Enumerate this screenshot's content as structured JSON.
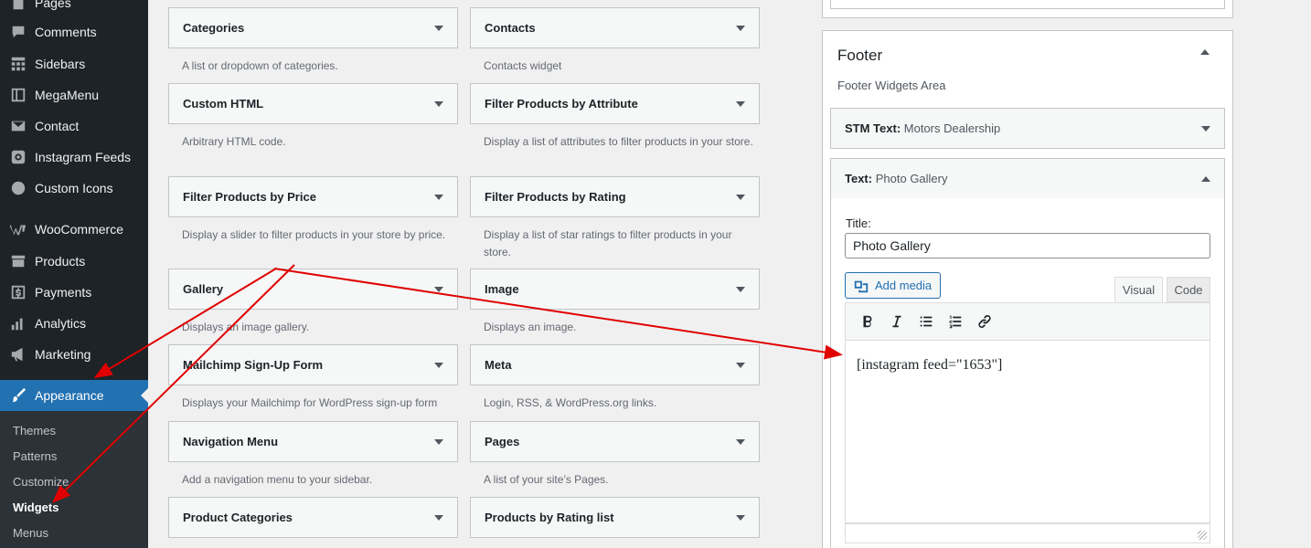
{
  "sidebar": {
    "items": [
      {
        "label": "Pages",
        "icon": "pages-icon"
      },
      {
        "label": "Comments",
        "icon": "comments-icon"
      },
      {
        "label": "Sidebars",
        "icon": "sidebars-icon"
      },
      {
        "label": "MegaMenu",
        "icon": "megamenu-icon"
      },
      {
        "label": "Contact",
        "icon": "mail-icon"
      },
      {
        "label": "Instagram Feeds",
        "icon": "instagram-icon"
      },
      {
        "label": "Custom Icons",
        "icon": "custom-icons-icon"
      },
      {
        "label": "WooCommerce",
        "icon": "woocommerce-icon"
      },
      {
        "label": "Products",
        "icon": "archive-icon"
      },
      {
        "label": "Payments",
        "icon": "dollar-icon"
      },
      {
        "label": "Analytics",
        "icon": "bar-chart-icon"
      },
      {
        "label": "Marketing",
        "icon": "megaphone-icon"
      },
      {
        "label": "Appearance",
        "icon": "paintbrush-icon"
      }
    ],
    "submenu": [
      "Themes",
      "Patterns",
      "Customize",
      "Widgets",
      "Menus"
    ]
  },
  "widgets": [
    {
      "title": "Categories",
      "desc": "A list or dropdown of categories."
    },
    {
      "title": "Contacts",
      "desc": "Contacts widget"
    },
    {
      "title": "Custom HTML",
      "desc": "Arbitrary HTML code."
    },
    {
      "title": "Filter Products by Attribute",
      "desc": "Display a list of attributes to filter products in your store."
    },
    {
      "title": "Filter Products by Price",
      "desc": "Display a slider to filter products in your store by price."
    },
    {
      "title": "Filter Products by Rating",
      "desc": "Display a list of star ratings to filter products in your store."
    },
    {
      "title": "Gallery",
      "desc": "Displays an image gallery."
    },
    {
      "title": "Image",
      "desc": "Displays an image."
    },
    {
      "title": "Mailchimp Sign-Up Form",
      "desc": "Displays your Mailchimp for WordPress sign-up form"
    },
    {
      "title": "Meta",
      "desc": "Login, RSS, & WordPress.org links."
    },
    {
      "title": "Navigation Menu",
      "desc": "Add a navigation menu to your sidebar."
    },
    {
      "title": "Pages",
      "desc": "A list of your site’s Pages."
    },
    {
      "title": "Product Categories",
      "desc": ""
    },
    {
      "title": "Products by Rating list",
      "desc": ""
    }
  ],
  "footer_area": {
    "title": "Footer",
    "description": "Footer Widgets Area",
    "widgets": [
      {
        "type": "STM Text:",
        "name": "Motors Dealership"
      },
      {
        "type": "Text:",
        "name": "Photo Gallery"
      }
    ],
    "text_widget": {
      "title_label": "Title:",
      "title_value": "Photo Gallery",
      "add_media_label": "Add media",
      "tab_visual": "Visual",
      "tab_code": "Code",
      "content": "[instagram feed=\"1653\"]"
    }
  },
  "colors": {
    "admin_dark": "#1d2327",
    "accent": "#2271b1",
    "arrow": "#e00000"
  }
}
